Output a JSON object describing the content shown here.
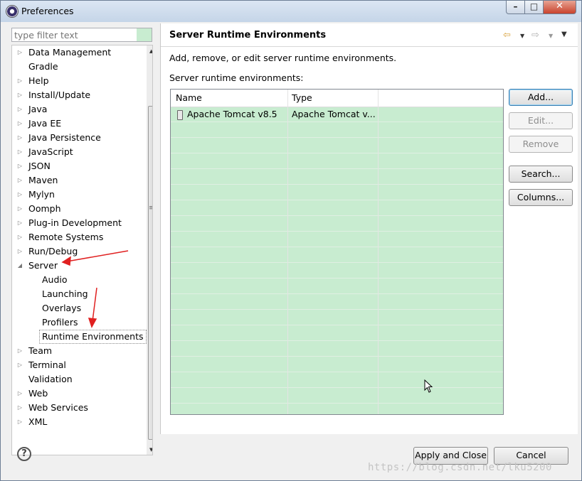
{
  "window": {
    "title": "Preferences",
    "min_glyph": "–",
    "max_glyph": "□",
    "close_glyph": "✕"
  },
  "sidebar": {
    "filter_placeholder": "type filter text",
    "items": [
      {
        "label": "Data Management",
        "arrow": "▷",
        "level": 0
      },
      {
        "label": "Gradle",
        "arrow": "",
        "level": 0
      },
      {
        "label": "Help",
        "arrow": "▷",
        "level": 0
      },
      {
        "label": "Install/Update",
        "arrow": "▷",
        "level": 0
      },
      {
        "label": "Java",
        "arrow": "▷",
        "level": 0
      },
      {
        "label": "Java EE",
        "arrow": "▷",
        "level": 0
      },
      {
        "label": "Java Persistence",
        "arrow": "▷",
        "level": 0
      },
      {
        "label": "JavaScript",
        "arrow": "▷",
        "level": 0
      },
      {
        "label": "JSON",
        "arrow": "▷",
        "level": 0
      },
      {
        "label": "Maven",
        "arrow": "▷",
        "level": 0
      },
      {
        "label": "Mylyn",
        "arrow": "▷",
        "level": 0
      },
      {
        "label": "Oomph",
        "arrow": "▷",
        "level": 0
      },
      {
        "label": "Plug-in Development",
        "arrow": "▷",
        "level": 0
      },
      {
        "label": "Remote Systems",
        "arrow": "▷",
        "level": 0
      },
      {
        "label": "Run/Debug",
        "arrow": "▷",
        "level": 0
      },
      {
        "label": "Server",
        "arrow": "◢",
        "level": 0
      },
      {
        "label": "Audio",
        "arrow": "",
        "level": 1
      },
      {
        "label": "Launching",
        "arrow": "",
        "level": 1
      },
      {
        "label": "Overlays",
        "arrow": "",
        "level": 1
      },
      {
        "label": "Profilers",
        "arrow": "",
        "level": 1
      },
      {
        "label": "Runtime Environments",
        "arrow": "",
        "level": 1,
        "selected": true
      },
      {
        "label": "Team",
        "arrow": "▷",
        "level": 0
      },
      {
        "label": "Terminal",
        "arrow": "▷",
        "level": 0
      },
      {
        "label": "Validation",
        "arrow": "",
        "level": 0
      },
      {
        "label": "Web",
        "arrow": "▷",
        "level": 0
      },
      {
        "label": "Web Services",
        "arrow": "▷",
        "level": 0
      },
      {
        "label": "XML",
        "arrow": "▷",
        "level": 0
      }
    ]
  },
  "main": {
    "title": "Server Runtime Environments",
    "nav": {
      "back": "⇦",
      "forward": "⇨",
      "dropdown": "▼",
      "menu": "▼"
    },
    "description": "Add, remove, or edit server runtime environments.",
    "table_label": "Server runtime environments:",
    "table": {
      "columns": [
        "Name",
        "Type"
      ],
      "rows": [
        {
          "name": "Apache Tomcat v8.5",
          "type": "Apache Tomcat v..."
        }
      ]
    },
    "buttons": {
      "add": "Add...",
      "edit": "Edit...",
      "remove": "Remove",
      "search": "Search...",
      "columns": "Columns..."
    }
  },
  "footer": {
    "help": "?",
    "apply_close": "Apply and Close",
    "cancel": "Cancel"
  },
  "watermark": "https://blog.csdn.net/lku5200"
}
